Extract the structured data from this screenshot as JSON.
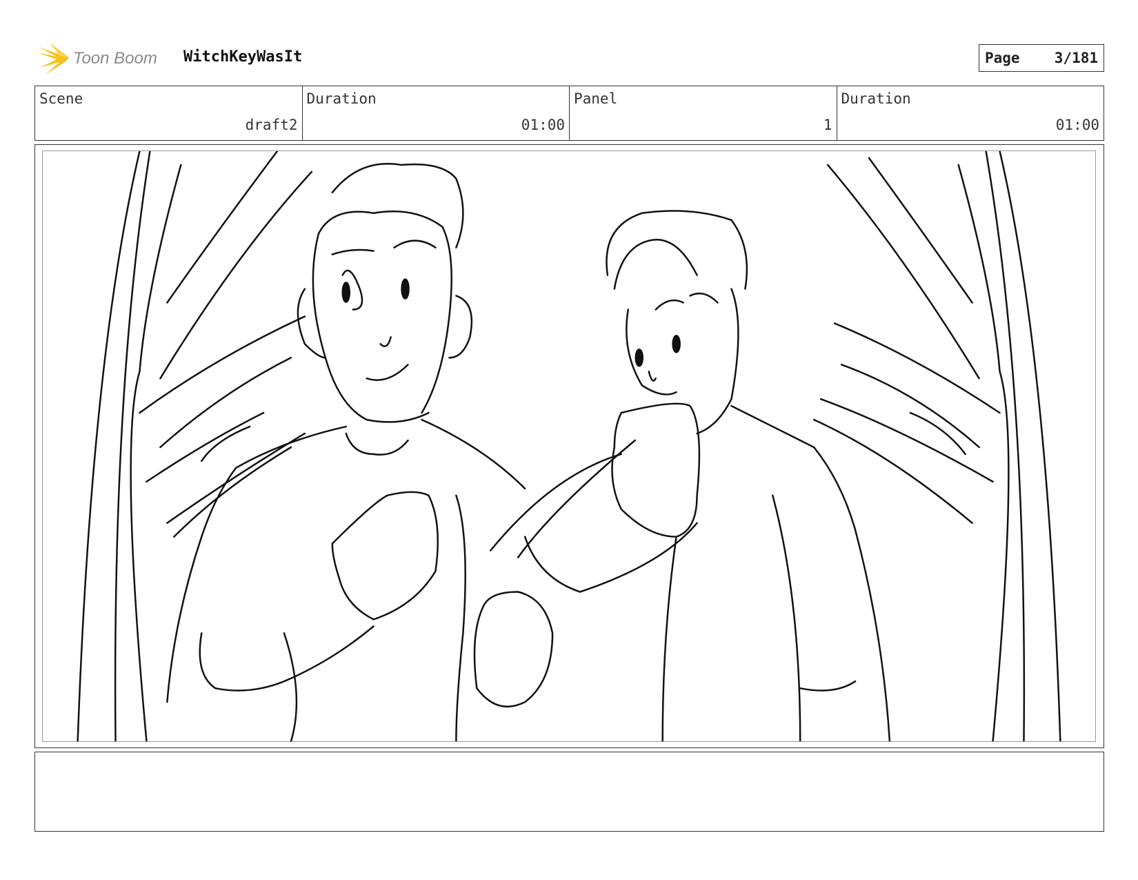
{
  "header": {
    "logo_text": "Toon Boom",
    "project_title": "WitchKeyWasIt",
    "page_label": "Page",
    "page_value": "3/181"
  },
  "info": {
    "scene_label": "Scene",
    "scene_value": "draft2",
    "scene_duration_label": "Duration",
    "scene_duration_value": "01:00",
    "panel_label": "Panel",
    "panel_value": "1",
    "panel_duration_label": "Duration",
    "panel_duration_value": "01:00"
  },
  "notes": {
    "text": ""
  },
  "colors": {
    "logo_star": "#f6c21a",
    "logo_text": "#8a8a8a"
  }
}
